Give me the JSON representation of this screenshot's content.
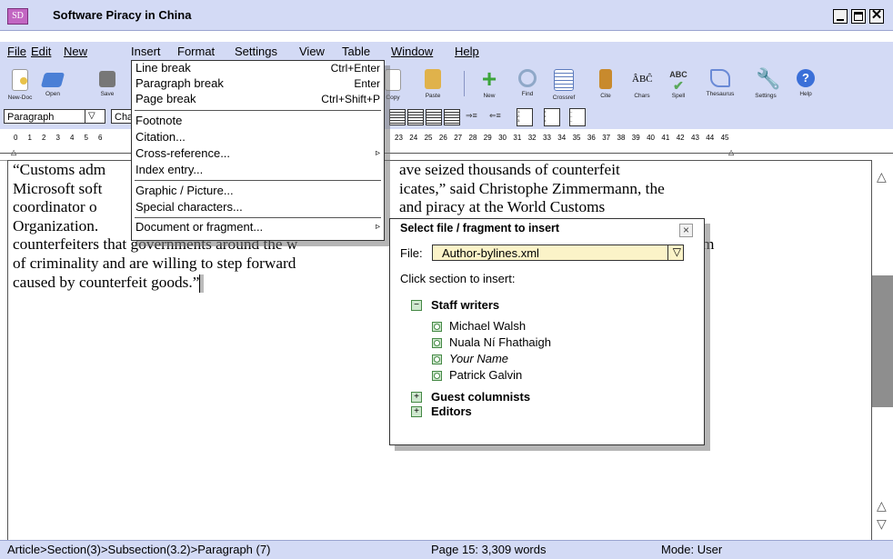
{
  "window": {
    "logo": "SD",
    "title": "Software Piracy in China"
  },
  "menubar": [
    "File",
    "Edit",
    "New",
    "Insert",
    "Format",
    "Settings",
    "View",
    "Table",
    "Window",
    "Help"
  ],
  "toolbar": {
    "left": [
      {
        "label": "New-Doc",
        "icon": "new-doc-icon",
        "color": "#e8c24a"
      },
      {
        "label": "Open",
        "icon": "open-folder-icon",
        "color": "#4a7fd6"
      },
      {
        "label": "Save",
        "icon": "save-disk-icon",
        "color": "#666666"
      }
    ],
    "right": [
      {
        "label": "Copy",
        "icon": "copy-icon",
        "color": "#e5c66a"
      },
      {
        "label": "Paste",
        "icon": "paste-icon",
        "color": "#e0b24b"
      },
      {
        "label": "New",
        "icon": "new-plus-icon",
        "color": "#3ba43b"
      },
      {
        "label": "Find",
        "icon": "find-magnifier-icon",
        "color": "#8fa8c8"
      },
      {
        "label": "Crossref",
        "icon": "crossref-icon",
        "color": "#5c7bbd"
      },
      {
        "label": "Cite",
        "icon": "cite-book-icon",
        "color": "#c88a2d"
      },
      {
        "label": "Chars",
        "icon": "chars-icon",
        "color": "#444444"
      },
      {
        "label": "Spell",
        "icon": "spell-check-icon",
        "color": "#5aa85a"
      },
      {
        "label": "Thesaurus",
        "icon": "thesaurus-icon",
        "color": "#6a8ad6"
      },
      {
        "label": "Settings",
        "icon": "settings-wrench-icon",
        "color": "#6d8bc2"
      },
      {
        "label": "Help",
        "icon": "help-icon",
        "color": "#3a6fd8"
      }
    ]
  },
  "formatbar": {
    "style_value": "Paragraph",
    "font_value": "Cha"
  },
  "ruler": {
    "numbers": [
      "0",
      "1",
      "2",
      "3",
      "4",
      "5",
      "6",
      "23",
      "24",
      "25",
      "26",
      "27",
      "28",
      "29",
      "30",
      "31",
      "32",
      "33",
      "34",
      "35",
      "36",
      "37",
      "38",
      "39",
      "40",
      "41",
      "42",
      "43",
      "44",
      "45"
    ]
  },
  "document": {
    "lines": [
      "“Customs adm",
      "Microsoft soft",
      "coordinator o",
      "Organization.",
      "counterfeiters that governments around the w",
      "of criminality and are willing to step forward",
      "caused by counterfeit goods.”"
    ],
    "lines_right": [
      "ave seized thousands of counterfeit",
      "icates,” said Christophe Zimmermann, the",
      "and piracy at the World Customs",
      "",
      "m",
      "",
      ""
    ]
  },
  "insert_menu": {
    "items": [
      {
        "label": "Line break",
        "shortcut": "Ctrl+Enter"
      },
      {
        "label": "Paragraph break",
        "shortcut": "Enter"
      },
      {
        "label": "Page break",
        "shortcut": "Ctrl+Shift+P"
      },
      {
        "label": "Footnote",
        "shortcut": ""
      },
      {
        "label": "Citation...",
        "shortcut": ""
      },
      {
        "label": "Cross-reference...",
        "shortcut": "▹"
      },
      {
        "label": "Index entry...",
        "shortcut": ""
      },
      {
        "label": "Graphic / Picture...",
        "shortcut": ""
      },
      {
        "label": "Special characters...",
        "shortcut": ""
      },
      {
        "label": "Document or fragment...",
        "shortcut": "▹"
      }
    ]
  },
  "popup": {
    "title": "Select file / fragment to insert",
    "close": "×",
    "file_label": "File:",
    "file_value": "Author-bylines.xml",
    "instruction": "Click section to insert:",
    "groups": [
      {
        "name": "Staff writers",
        "expanded": true,
        "toggle": "−",
        "items": [
          "Michael Walsh",
          "Nuala Ní Fhathaigh",
          "Your Name",
          "Patrick Galvin"
        ]
      },
      {
        "name": "Guest columnists",
        "expanded": false,
        "toggle": "+"
      },
      {
        "name": "Editors",
        "expanded": false,
        "toggle": "+"
      }
    ]
  },
  "status": {
    "breadcrumb": "Article>Section(3)>Subsection(3.2)>Paragraph (7)",
    "page": "Page 15: 3,309 words",
    "mode": "Mode: User"
  },
  "scrollbar": {
    "up": "△",
    "down": "▽"
  },
  "colors": {
    "chrome": "#d3daf5",
    "logo": "#c266c2",
    "field": "#fbf3c8",
    "tree": "#cfe8cf"
  }
}
